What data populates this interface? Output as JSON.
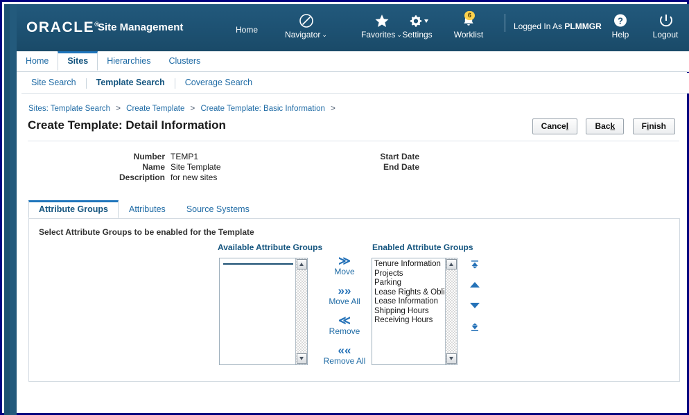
{
  "brand": {
    "logo_text": "ORACLE",
    "registered_mark": "®",
    "app_title": "Site Management"
  },
  "header": {
    "home_label": "Home",
    "navigator_label": "Navigator",
    "favorites_label": "Favorites",
    "settings_label": "Settings",
    "worklist_label": "Worklist",
    "worklist_badge": "6",
    "logged_in_prefix": "Logged In As ",
    "logged_in_user": "PLMMGR",
    "help_label": "Help",
    "logout_label": "Logout",
    "caret": "⌄",
    "icons": {
      "navigator": "compass-icon",
      "favorites": "star-icon",
      "settings": "gear-icon",
      "worklist": "bell-icon",
      "help": "question-mark-icon",
      "logout": "logout-icon"
    }
  },
  "main_tabs": [
    {
      "label": "Home",
      "active": false
    },
    {
      "label": "Sites",
      "active": true
    },
    {
      "label": "Hierarchies",
      "active": false
    },
    {
      "label": "Clusters",
      "active": false
    }
  ],
  "sub_tabs": [
    {
      "label": "Site Search",
      "active": false
    },
    {
      "label": "Template Search",
      "active": true
    },
    {
      "label": "Coverage Search",
      "active": false
    }
  ],
  "breadcrumb": {
    "separator": ">",
    "items": [
      "Sites: Template Search",
      "Create Template",
      "Create Template: Basic Information"
    ]
  },
  "page": {
    "title": "Create Template: Detail Information"
  },
  "actions": [
    {
      "label": "Cance",
      "accesskey": "l",
      "tail": "",
      "name": "cancel-button"
    },
    {
      "label": "Bac",
      "accesskey": "k",
      "tail": "",
      "name": "back-button"
    },
    {
      "label": "F",
      "accesskey": "i",
      "tail": "nish",
      "name": "finish-button"
    }
  ],
  "detail_fields": {
    "left": [
      {
        "label": "Number",
        "value": "TEMP1"
      },
      {
        "label": "Name",
        "value": "Site Template"
      },
      {
        "label": "Description",
        "value": "for new sites"
      }
    ],
    "right": [
      {
        "label": "Start Date",
        "value": ""
      },
      {
        "label": "End Date",
        "value": ""
      }
    ]
  },
  "content_tabs": [
    {
      "label": "Attribute Groups",
      "active": true
    },
    {
      "label": "Attributes",
      "active": false
    },
    {
      "label": "Source Systems",
      "active": false
    }
  ],
  "shuttle": {
    "instruction": "Select Attribute Groups to be enabled for the Template",
    "available_header": "Available Attribute Groups",
    "enabled_header": "Enabled Attribute Groups",
    "available_items": [],
    "enabled_items": [
      "Tenure Information",
      "Projects",
      "Parking",
      "Lease Rights & Oblig",
      "Lease Information",
      "Shipping Hours",
      "Receiving Hours"
    ],
    "move_buttons": [
      {
        "glyph": "≫",
        "label": "Move",
        "name": "move-button"
      },
      {
        "glyph": "»»",
        "label": "Move All",
        "name": "move-all-button"
      },
      {
        "glyph": "≪",
        "label": "Remove",
        "name": "remove-button"
      },
      {
        "glyph": "««",
        "label": "Remove All",
        "name": "remove-all-button"
      }
    ],
    "reorder_buttons": [
      "move-to-top-icon",
      "move-up-icon",
      "move-down-icon",
      "move-to-bottom-icon"
    ]
  },
  "colors": {
    "header_bg": "#1d5172",
    "frame_border": "#000080",
    "link_blue": "#1f6ba5",
    "active_tab_accent": "#1f75bc",
    "badge_yellow": "#ffd24d"
  }
}
